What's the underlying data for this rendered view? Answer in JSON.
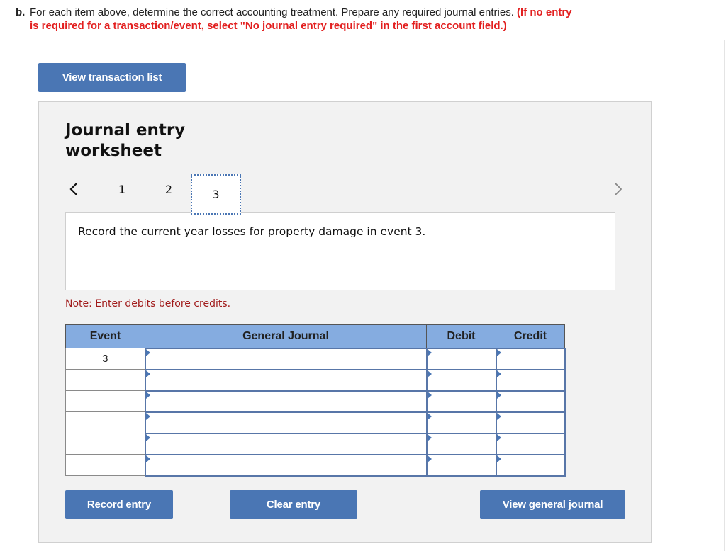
{
  "instructions": {
    "label": "b.",
    "text": "For each item above, determine the correct accounting treatment. Prepare any required journal entries.",
    "highlight": "(If no entry is required for a transaction/event, select \"No journal entry required\" in the first account field.)"
  },
  "buttons": {
    "view_transaction_list": "View transaction list",
    "record_entry": "Record entry",
    "clear_entry": "Clear entry",
    "view_general_journal": "View general journal"
  },
  "worksheet": {
    "title": "Journal entry worksheet",
    "pages": [
      "1",
      "2",
      "3"
    ],
    "current_page": "3",
    "prev_icon": "chevron-left-icon",
    "next_icon": "chevron-right-icon",
    "prompt": "Record the current year losses for property damage in event 3.",
    "note": "Note: Enter debits before credits."
  },
  "journal_table": {
    "headers": [
      "Event",
      "General Journal",
      "Debit",
      "Credit"
    ],
    "rows": [
      {
        "event": "3",
        "account": "",
        "debit": "",
        "credit": ""
      },
      {
        "event": "",
        "account": "",
        "debit": "",
        "credit": ""
      },
      {
        "event": "",
        "account": "",
        "debit": "",
        "credit": ""
      },
      {
        "event": "",
        "account": "",
        "debit": "",
        "credit": ""
      },
      {
        "event": "",
        "account": "",
        "debit": "",
        "credit": ""
      },
      {
        "event": "",
        "account": "",
        "debit": "",
        "credit": ""
      }
    ]
  },
  "colors": {
    "button_blue": "#4a76b4",
    "header_blue": "#85ace0",
    "instruction_red": "#e21f1f",
    "note_red": "#a11b1b"
  }
}
